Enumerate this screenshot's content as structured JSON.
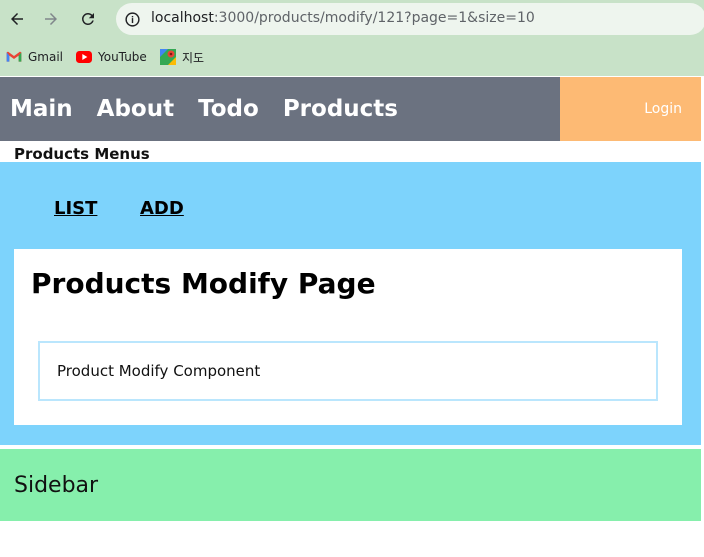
{
  "browser": {
    "url_host": "localhost",
    "url_rest": ":3000/products/modify/121?page=1&size=10",
    "bookmarks": [
      {
        "label": "Gmail",
        "icon": "gmail-icon"
      },
      {
        "label": "YouTube",
        "icon": "youtube-icon"
      },
      {
        "label": "지도",
        "icon": "maps-icon"
      }
    ]
  },
  "nav": {
    "links": [
      "Main",
      "About",
      "Todo",
      "Products"
    ],
    "login": "Login"
  },
  "products_menu": {
    "title": "Products Menus",
    "links": [
      "LIST",
      "ADD"
    ]
  },
  "page": {
    "title": "Products Modify Page",
    "component": "Product Modify Component"
  },
  "sidebar": {
    "label": "Sidebar"
  },
  "colors": {
    "nav_bg": "#6b7280",
    "login_bg": "#fdba74",
    "menu_bg": "#7dd3fc",
    "sidebar_bg": "#86efac",
    "chrome_bg": "#c8e2c8"
  }
}
